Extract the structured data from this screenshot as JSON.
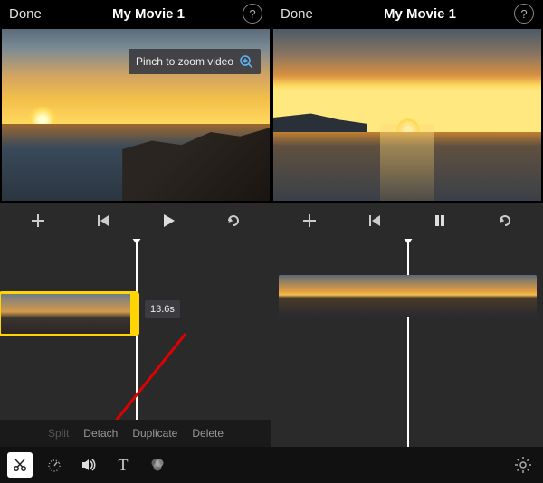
{
  "left": {
    "done": "Done",
    "title": "My Movie 1",
    "tooltip": "Pinch to zoom video",
    "duration": "13.6s",
    "edit": {
      "split": "Split",
      "detach": "Detach",
      "duplicate": "Duplicate",
      "delete": "Delete"
    }
  },
  "right": {
    "done": "Done",
    "title": "My Movie 1"
  },
  "help_glyph": "?"
}
